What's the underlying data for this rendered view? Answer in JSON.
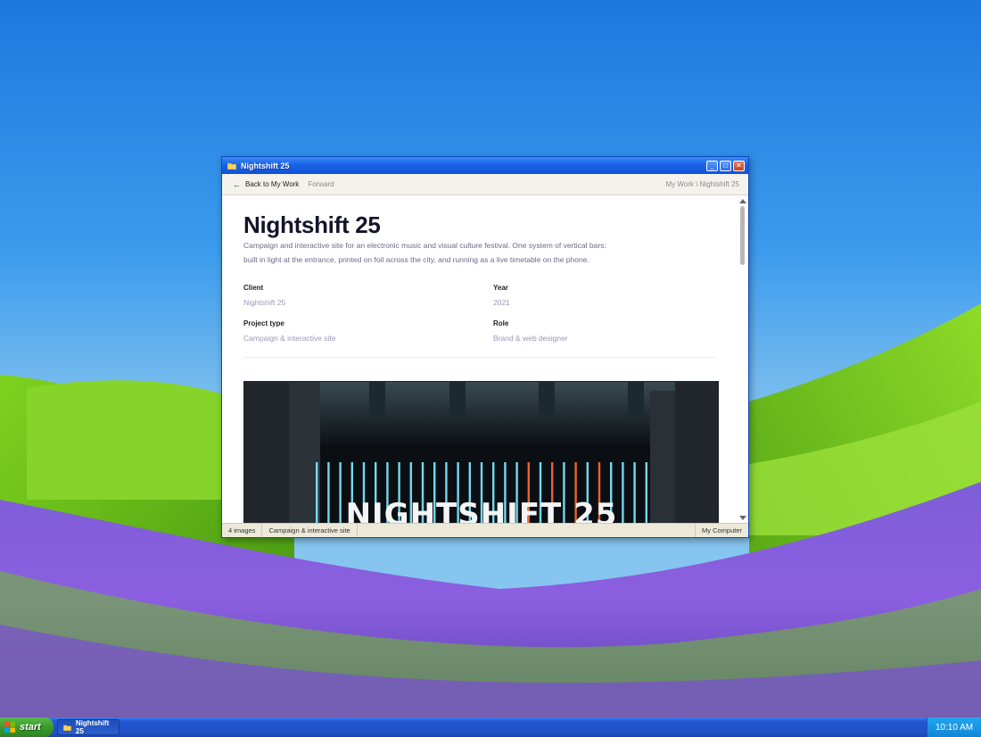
{
  "window": {
    "title": "Nightshift 25",
    "minimize_glyph": "_",
    "maximize_glyph": "□",
    "close_glyph": "✕"
  },
  "toolbar": {
    "back_arrow": "←",
    "back_label": "Back to My Work",
    "forward_label": "Forward",
    "breadcrumb": "My Work \\ Nightshift 25"
  },
  "project": {
    "title": "Nightshift 25",
    "summary_line1": "Campaign and interactive site for an electronic music and visual culture festival. One system of vertical bars:",
    "summary_line2": "built in light at the entrance, printed on foil across the city, and running as a live timetable on the phone.",
    "meta": {
      "client_label": "Client",
      "client_value": "Nightshift 25",
      "year_label": "Year",
      "year_value": "2021",
      "type_label": "Project type",
      "type_value": "Campaign & interactive site",
      "role_label": "Role",
      "role_value": "Brand & web designer"
    },
    "hero_text": "NIGHTSHIFT 25"
  },
  "statusbar": {
    "count": "4 images",
    "category": "Campaign & interactive site",
    "zone": "My Computer"
  },
  "taskbar": {
    "start_label": "start",
    "task_label": "Nightshift 25",
    "clock": "10:10 AM"
  },
  "colors": {
    "titlebar": "#1a62e6",
    "taskbar": "#2150c6",
    "start": "#3a9a2e",
    "tray": "#1086d6",
    "meta_value": "#9a97b8",
    "bar_cyan": "#7fe9ff",
    "bar_orange": "#ff6a2a"
  }
}
